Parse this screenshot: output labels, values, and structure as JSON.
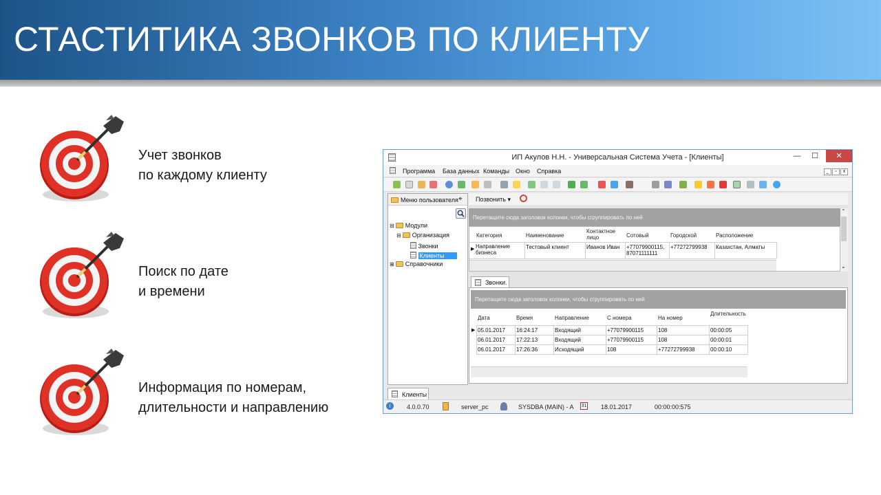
{
  "slide": {
    "title": "СТАСТИТИКА ЗВОНКОВ ПО КЛИЕНТУ",
    "bullets": [
      {
        "line1": "Учет звонков",
        "line2": "по каждому клиенту"
      },
      {
        "line1": "Поиск по дате",
        "line2": "и времени"
      },
      {
        "line1": "Информация по номерам,",
        "line2": "длительности и направлению"
      }
    ],
    "colors": {
      "header_start": "#1d5488",
      "header_end": "#7cc1f5",
      "target_red": "#d42a20"
    }
  },
  "window": {
    "title": "ИП Акулов Н.Н. - Универсальная Система Учета - [Клиенты]",
    "minimize": "—",
    "maximize": "☐",
    "close": "✕",
    "menu": [
      "Программа",
      "База данных",
      "Команды",
      "Окно",
      "Справка"
    ],
    "user_menu_title": "Меню пользователя",
    "pin": "⌖",
    "tree": {
      "modules": "Модули",
      "organization": "Организация",
      "calls": "Звонки",
      "clients": "Клиенты",
      "references": "Справочники"
    },
    "call_button": "Позвонить",
    "group_hint": "Перетащите сюда заголовок колонки, чтобы сгруппировать по ней",
    "clients_grid": {
      "columns": [
        "Категория",
        "Наименование",
        "Контактное лицо",
        "Сотовый",
        "Городской",
        "Расположение"
      ],
      "row": {
        "category": "Направление бизнеса",
        "name": "Тестовый клиент",
        "contact": "Иванов Иван",
        "mobile": "+77079900115, 87071111111",
        "city": "+77272799938",
        "location": "Казахстан, Алматы"
      }
    },
    "calls_tab": "Звонки.",
    "calls_grid": {
      "columns": [
        "Дата",
        "Время",
        "Направление",
        "С номера",
        "На номер",
        "Длительность"
      ],
      "rows": [
        [
          "05.01.2017",
          "16:24:17",
          "Входящий",
          "+77079900115",
          "108",
          "00:00:05"
        ],
        [
          "06.01.2017",
          "17:22:13",
          "Входящий",
          "+77079900115",
          "108",
          "00:00:01"
        ],
        [
          "06.01.2017",
          "17:26:36",
          "Исходящий",
          "108",
          "+77272799938",
          "00:00:10"
        ]
      ]
    },
    "bottom_tab": "Клиенты",
    "status": {
      "version": "4.0.0.70",
      "server": "server_pc",
      "user": "SYSDBA (MAIN) - A",
      "date": "18.01.2017",
      "timer": "00:00:00:575",
      "calendar_day": "31"
    }
  }
}
